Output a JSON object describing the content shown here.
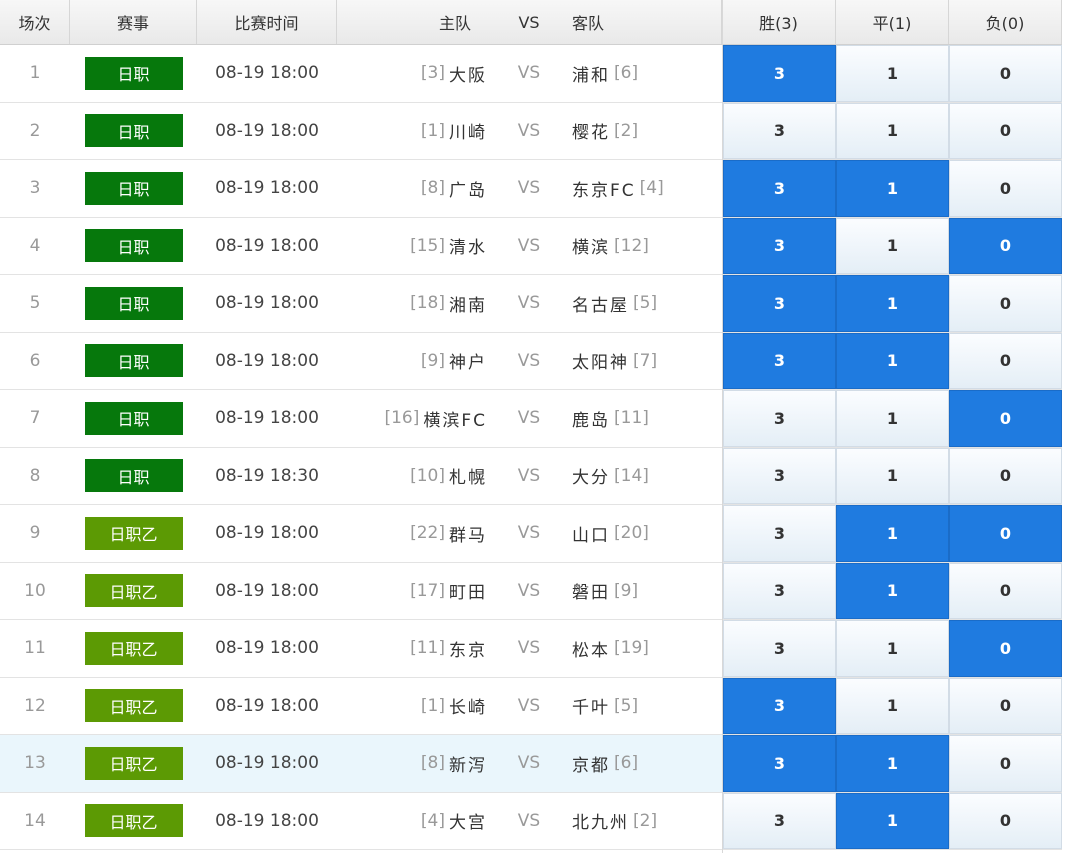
{
  "header": {
    "no": "场次",
    "league": "赛事",
    "time": "比赛时间",
    "home": "主队",
    "vs": "VS",
    "away": "客队",
    "win": "胜(3)",
    "draw": "平(1)",
    "lose": "负(0)"
  },
  "colors": {
    "selected": "#1f7be0",
    "j1_badge": "#06780c",
    "j2_badge": "#5c9a04",
    "highlight_row": "#eaf6fc"
  },
  "matches": [
    {
      "no": "1",
      "league": "日职",
      "tier": "j1",
      "time": "08-19 18:00",
      "home_rank": "[3]",
      "home": "大阪",
      "vs": "VS",
      "away": "浦和",
      "away_rank": "[6]",
      "win": "3",
      "draw": "1",
      "lose": "0",
      "selected": [
        "win"
      ]
    },
    {
      "no": "2",
      "league": "日职",
      "tier": "j1",
      "time": "08-19 18:00",
      "home_rank": "[1]",
      "home": "川崎",
      "vs": "VS",
      "away": "樱花",
      "away_rank": "[2]",
      "win": "3",
      "draw": "1",
      "lose": "0",
      "selected": []
    },
    {
      "no": "3",
      "league": "日职",
      "tier": "j1",
      "time": "08-19 18:00",
      "home_rank": "[8]",
      "home": "广岛",
      "vs": "VS",
      "away": "东京FC",
      "away_rank": "[4]",
      "win": "3",
      "draw": "1",
      "lose": "0",
      "selected": [
        "win",
        "draw"
      ]
    },
    {
      "no": "4",
      "league": "日职",
      "tier": "j1",
      "time": "08-19 18:00",
      "home_rank": "[15]",
      "home": "清水",
      "vs": "VS",
      "away": "横滨",
      "away_rank": "[12]",
      "win": "3",
      "draw": "1",
      "lose": "0",
      "selected": [
        "win",
        "lose"
      ]
    },
    {
      "no": "5",
      "league": "日职",
      "tier": "j1",
      "time": "08-19 18:00",
      "home_rank": "[18]",
      "home": "湘南",
      "vs": "VS",
      "away": "名古屋",
      "away_rank": "[5]",
      "win": "3",
      "draw": "1",
      "lose": "0",
      "selected": [
        "win",
        "draw"
      ]
    },
    {
      "no": "6",
      "league": "日职",
      "tier": "j1",
      "time": "08-19 18:00",
      "home_rank": "[9]",
      "home": "神户",
      "vs": "VS",
      "away": "太阳神",
      "away_rank": "[7]",
      "win": "3",
      "draw": "1",
      "lose": "0",
      "selected": [
        "win",
        "draw"
      ]
    },
    {
      "no": "7",
      "league": "日职",
      "tier": "j1",
      "time": "08-19 18:00",
      "home_rank": "[16]",
      "home": "横滨FC",
      "vs": "VS",
      "away": "鹿岛",
      "away_rank": "[11]",
      "win": "3",
      "draw": "1",
      "lose": "0",
      "selected": [
        "lose"
      ]
    },
    {
      "no": "8",
      "league": "日职",
      "tier": "j1",
      "time": "08-19 18:30",
      "home_rank": "[10]",
      "home": "札幌",
      "vs": "VS",
      "away": "大分",
      "away_rank": "[14]",
      "win": "3",
      "draw": "1",
      "lose": "0",
      "selected": []
    },
    {
      "no": "9",
      "league": "日职乙",
      "tier": "j2",
      "time": "08-19 18:00",
      "home_rank": "[22]",
      "home": "群马",
      "vs": "VS",
      "away": "山口",
      "away_rank": "[20]",
      "win": "3",
      "draw": "1",
      "lose": "0",
      "selected": [
        "draw",
        "lose"
      ]
    },
    {
      "no": "10",
      "league": "日职乙",
      "tier": "j2",
      "time": "08-19 18:00",
      "home_rank": "[17]",
      "home": "町田",
      "vs": "VS",
      "away": "磐田",
      "away_rank": "[9]",
      "win": "3",
      "draw": "1",
      "lose": "0",
      "selected": [
        "draw"
      ]
    },
    {
      "no": "11",
      "league": "日职乙",
      "tier": "j2",
      "time": "08-19 18:00",
      "home_rank": "[11]",
      "home": "东京",
      "vs": "VS",
      "away": "松本",
      "away_rank": "[19]",
      "win": "3",
      "draw": "1",
      "lose": "0",
      "selected": [
        "lose"
      ]
    },
    {
      "no": "12",
      "league": "日职乙",
      "tier": "j2",
      "time": "08-19 18:00",
      "home_rank": "[1]",
      "home": "长崎",
      "vs": "VS",
      "away": "千叶",
      "away_rank": "[5]",
      "win": "3",
      "draw": "1",
      "lose": "0",
      "selected": [
        "win"
      ]
    },
    {
      "no": "13",
      "league": "日职乙",
      "tier": "j2",
      "time": "08-19 18:00",
      "home_rank": "[8]",
      "home": "新泻",
      "vs": "VS",
      "away": "京都",
      "away_rank": "[6]",
      "win": "3",
      "draw": "1",
      "lose": "0",
      "selected": [
        "win",
        "draw"
      ],
      "highlight": true
    },
    {
      "no": "14",
      "league": "日职乙",
      "tier": "j2",
      "time": "08-19 18:00",
      "home_rank": "[4]",
      "home": "大宫",
      "vs": "VS",
      "away": "北九州",
      "away_rank": "[2]",
      "win": "3",
      "draw": "1",
      "lose": "0",
      "selected": [
        "draw"
      ]
    }
  ]
}
